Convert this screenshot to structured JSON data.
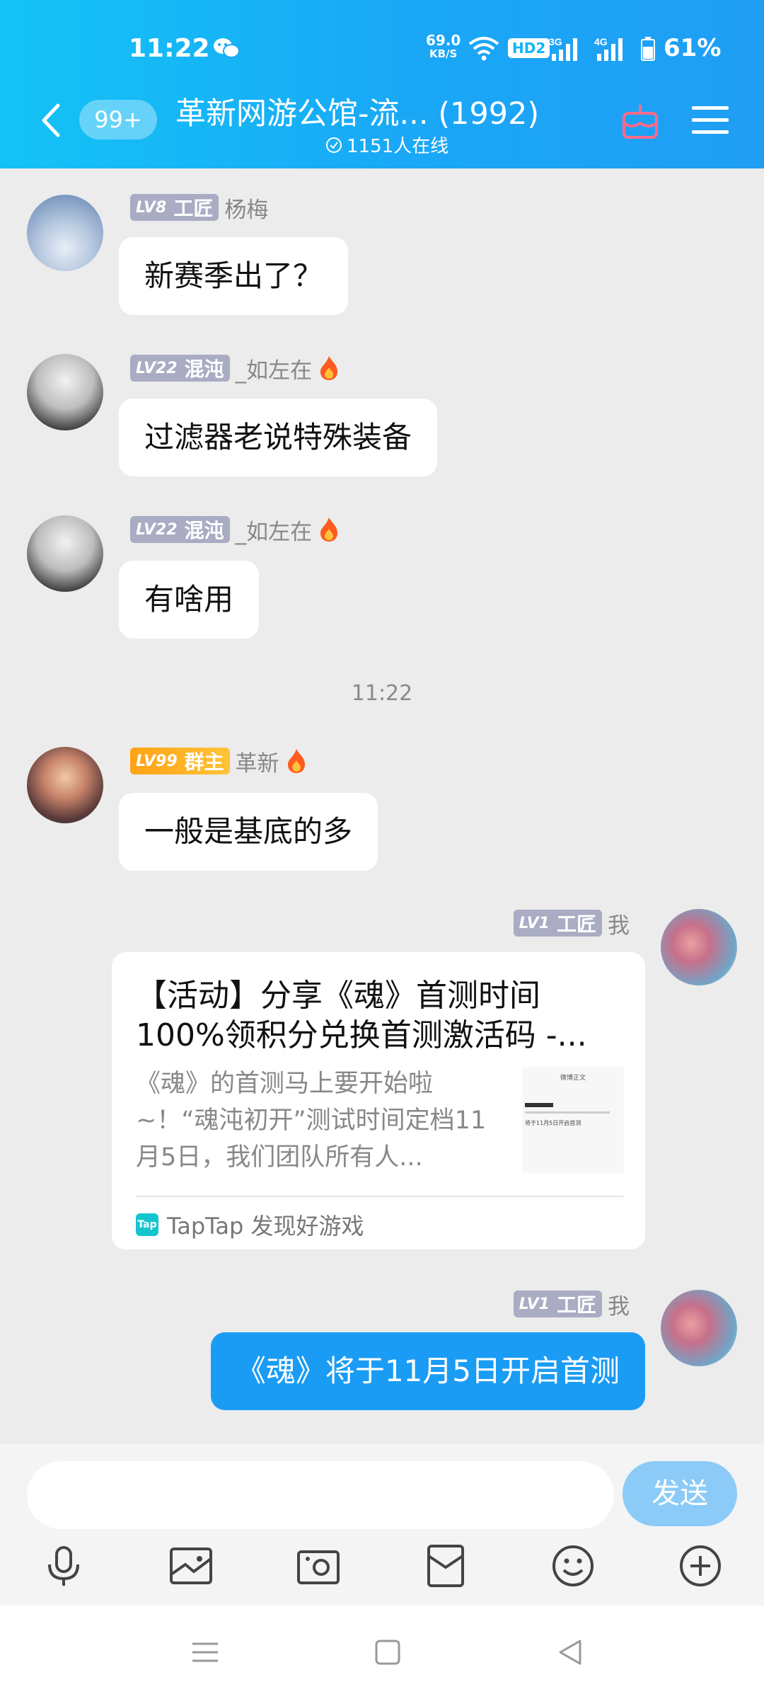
{
  "status_bar": {
    "time": "11:22",
    "net_speed_value": "69.0",
    "net_speed_unit": "KB/S",
    "hd_label": "HD2",
    "sig1_label": "3G",
    "sig2_label": "4G",
    "battery": "61%"
  },
  "header": {
    "unread_count": "99+",
    "title": "革新网游公馆-流... (1992)",
    "online": "1151人在线"
  },
  "messages": [
    {
      "level": "LV8",
      "role": "工匠",
      "sender": "杨梅",
      "text": "新赛季出了？"
    },
    {
      "level": "LV22",
      "role": "混沌",
      "sender": "_如左在",
      "text": "过滤器老说特殊装备"
    },
    {
      "level": "LV22",
      "role": "混沌",
      "sender": "_如左在",
      "text": "有啥用"
    },
    {
      "level": "LV99",
      "role": "群主",
      "sender": "革新",
      "text": "一般是基底的多"
    }
  ],
  "timestamp": "11:22",
  "my_card": {
    "level": "LV1",
    "role": "工匠",
    "sender": "我",
    "title": "【活动】分享《魂》首测时间100%领积分兑换首测激活码 -...",
    "desc": "《魂》的首测马上要开始啦~！“魂沌初开”测试时间定档11月5日，我们团队所有人...",
    "source_icon": "Tap",
    "source": "TapTap 发现好游戏",
    "thumb_text": "微博正文",
    "thumb_line": "将于11月5日开启首测"
  },
  "my_message": {
    "level": "LV1",
    "role": "工匠",
    "sender": "我",
    "text": "《魂》将于11月5日开启首测"
  },
  "input": {
    "send_label": "发送"
  },
  "colors": {
    "header": "#1aa7f6",
    "accent": "#1a9cf5",
    "send_disabled": "#8ccbf7"
  }
}
